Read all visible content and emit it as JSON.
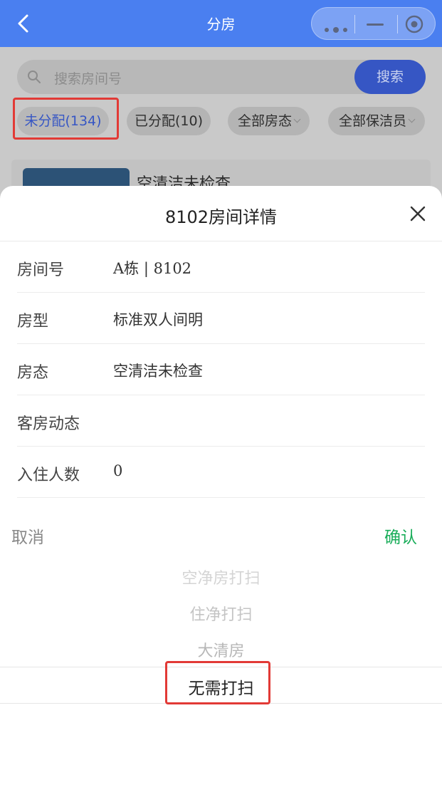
{
  "nav": {
    "title": "分房",
    "back_icon": "chevron-left-icon",
    "more_icon": "more-dots-icon",
    "minimize_icon": "minimize-icon",
    "close_icon": "target-close-icon"
  },
  "search": {
    "placeholder": "搜索房间号",
    "button": "搜索"
  },
  "filters": [
    {
      "label": "未分配(134)",
      "active": true
    },
    {
      "label": "已分配(10)"
    },
    {
      "label": "全部房态"
    },
    {
      "label": "全部保洁员"
    }
  ],
  "card": {
    "title": "空清洁未检查"
  },
  "sheet": {
    "title": "8102房间详情",
    "rows": [
      {
        "label": "房间号",
        "value": "A栋 | 8102"
      },
      {
        "label": "房型",
        "value": "标准双人间明"
      },
      {
        "label": "房态",
        "value": "空清洁未检查"
      },
      {
        "label": "客房动态",
        "value": ""
      },
      {
        "label": "入住人数",
        "value": "0"
      }
    ]
  },
  "picker": {
    "cancel": "取消",
    "confirm": "确认",
    "options": [
      "空净房打扫",
      "住净打扫",
      "大清房",
      "无需打扫"
    ],
    "selected": "无需打扫"
  },
  "colors": {
    "nav_bg": "#4a7ff0",
    "accent_blue": "#3656c4",
    "confirm_green": "#1aad5a",
    "highlight_red": "#e23a36"
  }
}
